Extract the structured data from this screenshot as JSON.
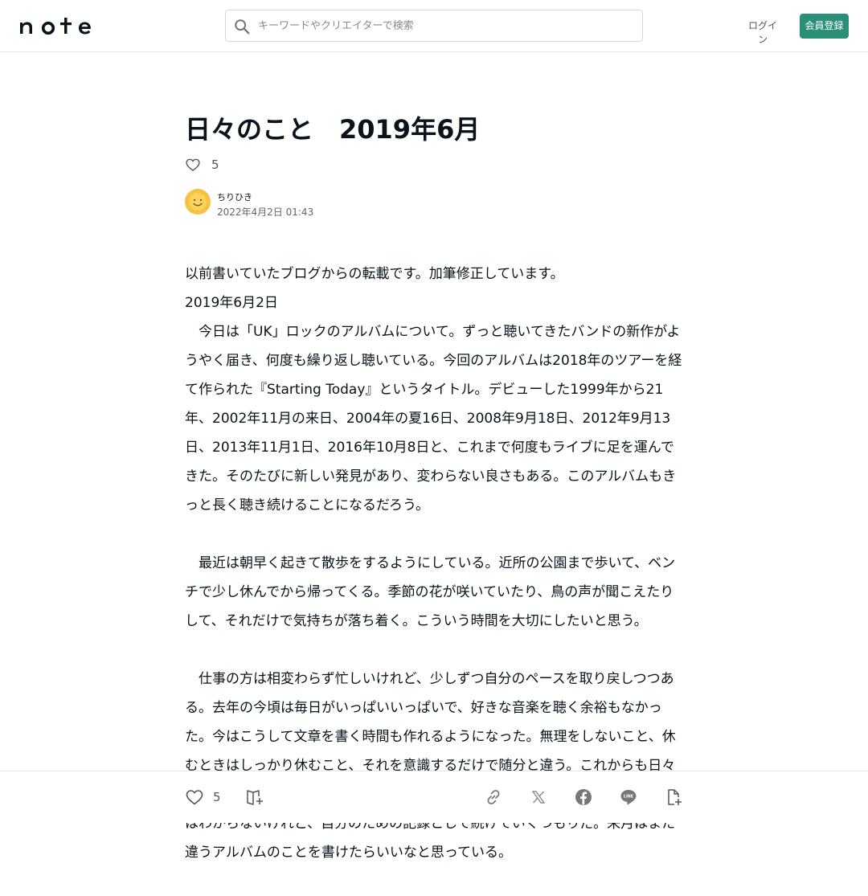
{
  "header": {
    "logo_text": "note",
    "search_placeholder": "キーワードやクリエイターで検索",
    "login_label": "ログイン",
    "signup_label": "会員登録"
  },
  "article": {
    "title": "日々のこと　2019年6月",
    "like_count": "5",
    "author_name": "ちりひき",
    "date": "2022年4月2日 01:43",
    "paragraphs": [
      "以前書いていたブログからの転載です。加筆修正しています。",
      "2019年6月2日",
      "　今日は「UK」ロックのアルバムについて。ずっと聴いてきたバンドの新作がようやく届き、何度も繰り返し聴いている。今回のアルバムは2018年のツアーを経て作られた『Starting Today』というタイトル。デビューした1999年から21年、2002年11月の来日、2004年の夏16日、2008年9月18日、2012年9月13日、2013年11月1日、2016年10月8日と、これまで何度もライブに足を運んできた。そのたびに新しい発見があり、変わらない良さもある。このアルバムもきっと長く聴き続けることになるだろう。",
      "　最近は朝早く起きて散歩をするようにしている。近所の公園まで歩いて、ベンチで少し休んでから帰ってくる。季節の花が咲いていたり、鳥の声が聞こえたりして、それだけで気持ちが落ち着く。こういう時間を大切にしたいと思う。",
      "　仕事の方は相変わらず忙しいけれど、少しずつ自分のペースを取り戻しつつある。去年の今頃は毎日がいっぱいいっぱいで、好きな音楽を聴く余裕もなかった。今はこうして文章を書く時間も作れるようになった。無理をしないこと、休むときはしっかり休むこと、それを意識するだけで随分と違う。これからも日々のことを少しずつ書き残していきたいと思う。読んでくださる方がいるかどうかはわからないけれど、自分のための記録として続けていくつもりだ。来月はまた違うアルバムのことを書けたらいいなと思っている。"
    ]
  },
  "footer": {
    "like_count": "5"
  },
  "icons": {
    "heart": "heart-icon",
    "magazine": "magazine-add-icon",
    "link": "link-icon",
    "x": "x-share-icon",
    "facebook": "facebook-icon",
    "line": "line-icon",
    "embed": "embed-icon"
  },
  "colors": {
    "brand": "#2a8f78",
    "text": "#08131a",
    "muted": "#555555"
  }
}
